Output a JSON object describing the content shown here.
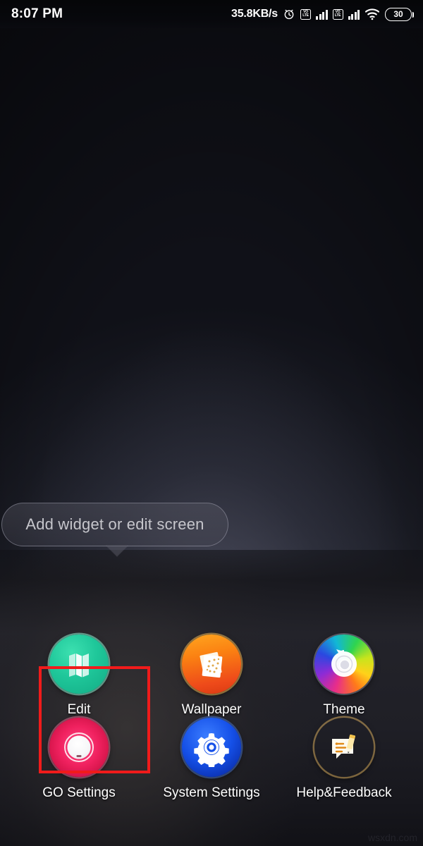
{
  "statusbar": {
    "time": "8:07 PM",
    "network_speed": "35.8KB/s",
    "alarm_icon": "alarm-clock-icon",
    "sim1_label_top": "VO",
    "sim1_label_bottom": "LTE",
    "sim2_label_top": "VO",
    "sim2_label_bottom": "LTE",
    "wifi_icon": "wifi-icon",
    "battery_level": "30"
  },
  "tooltip": {
    "text": "Add widget or edit screen"
  },
  "menu": {
    "items": [
      {
        "label": "Edit",
        "icon": "edit-panels-icon",
        "color": "#1fc79a"
      },
      {
        "label": "Wallpaper",
        "icon": "wallpaper-icon",
        "color": "#fb8112"
      },
      {
        "label": "Theme",
        "icon": "theme-palette-icon",
        "color": "#8d2bd6"
      },
      {
        "label": "GO Settings",
        "icon": "go-settings-icon",
        "color": "#f0215f"
      },
      {
        "label": "System Settings",
        "icon": "gear-icon",
        "color": "#1550e8"
      },
      {
        "label": "Help&Feedback",
        "icon": "help-feedback-icon",
        "color": "#fb9412"
      }
    ],
    "selected_index": 3,
    "selection_color": "#f01b1b"
  },
  "watermark": {
    "text": "wsxdn.com"
  }
}
